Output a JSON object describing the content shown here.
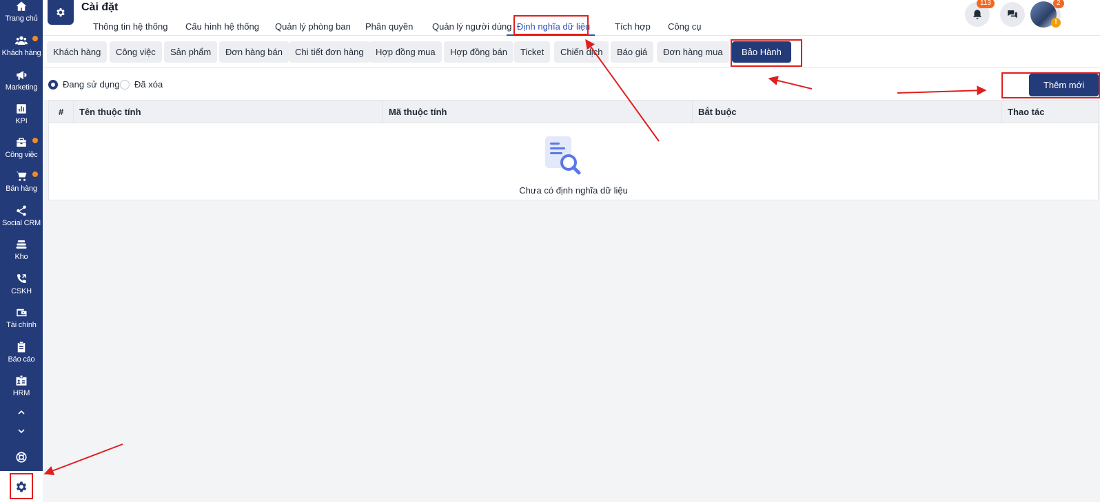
{
  "sidebar": {
    "items": [
      {
        "label": "Trang chủ",
        "icon": "home-icon"
      },
      {
        "label": "Khách hàng",
        "icon": "users-icon",
        "dot": true
      },
      {
        "label": "Marketing",
        "icon": "megaphone-icon"
      },
      {
        "label": "KPI",
        "icon": "chart-icon"
      },
      {
        "label": "Công việc",
        "icon": "briefcase-icon",
        "dot": true
      },
      {
        "label": "Bán hàng",
        "icon": "cart-icon",
        "dot": true
      },
      {
        "label": "Social CRM",
        "icon": "share-icon"
      },
      {
        "label": "Kho",
        "icon": "warehouse-icon"
      },
      {
        "label": "CSKH",
        "icon": "phone-icon"
      },
      {
        "label": "Tài chính",
        "icon": "wallet-icon"
      },
      {
        "label": "Báo cáo",
        "icon": "clipboard-icon"
      },
      {
        "label": "HRM",
        "icon": "id-card-icon"
      }
    ]
  },
  "header": {
    "title": "Cài đặt",
    "tabs": [
      {
        "label": "Thông tin hệ thống"
      },
      {
        "label": "Cấu hình hệ thống"
      },
      {
        "label": "Quản lý phòng ban"
      },
      {
        "label": "Phân quyền"
      },
      {
        "label": "Quản lý người dùng"
      },
      {
        "label": "Định nghĩa dữ liệu",
        "active": true
      },
      {
        "label": "Tích hợp"
      },
      {
        "label": "Công cụ"
      }
    ],
    "notifications_count": "113",
    "rocket_count": "2",
    "avatar_warning": "!"
  },
  "subtabs": [
    {
      "label": "Khách hàng"
    },
    {
      "label": "Công việc"
    },
    {
      "label": "Sản phẩm"
    },
    {
      "label": "Đơn hàng bán"
    },
    {
      "label": "Chi tiết đơn hàng"
    },
    {
      "label": "Hợp đồng mua"
    },
    {
      "label": "Hợp đồng bán"
    },
    {
      "label": "Ticket"
    },
    {
      "label": "Chiến dịch"
    },
    {
      "label": "Báo giá"
    },
    {
      "label": "Đơn hàng mua"
    },
    {
      "label": "Bảo Hành",
      "active": true
    }
  ],
  "filters": {
    "in_use": "Đang sử dụng",
    "deleted": "Đã xóa",
    "selected": "in_use"
  },
  "actions": {
    "add_new": "Thêm mới"
  },
  "table": {
    "columns": [
      "#",
      "Tên thuộc tính",
      "Mã thuộc tính",
      "Bắt buộc",
      "Thao tác"
    ],
    "rows": [],
    "empty_text": "Chưa có định nghĩa dữ liệu"
  },
  "colors": {
    "primary": "#243b7a",
    "accent_text": "#2f4fb5",
    "badge": "#f06a24",
    "annotation": "#e01e1e"
  }
}
